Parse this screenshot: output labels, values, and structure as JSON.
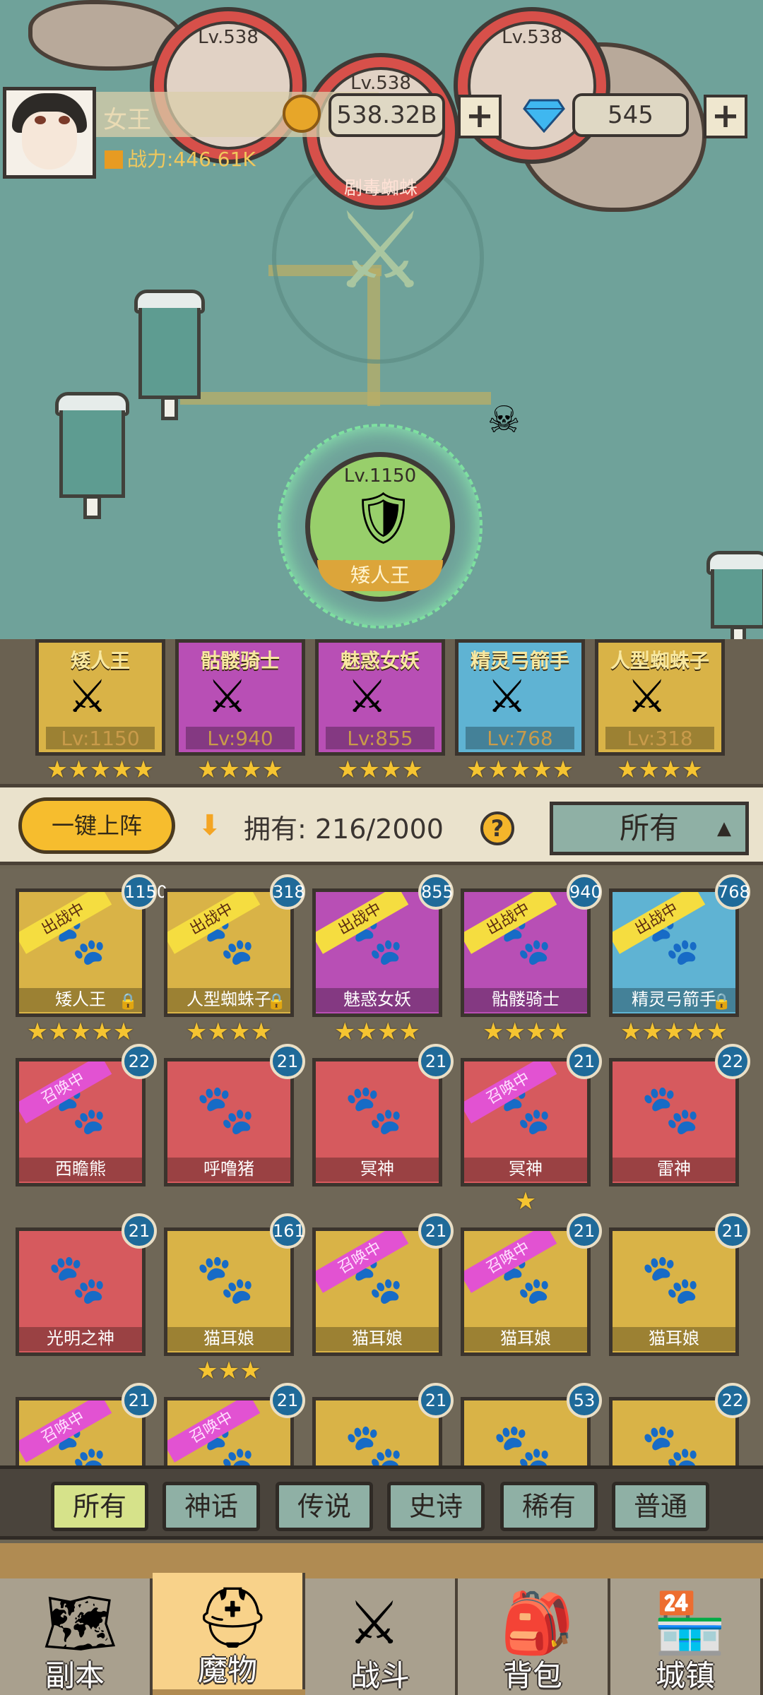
{
  "player": {
    "name": "女王",
    "power": "战力:446.61K",
    "gold": "538.32B",
    "gems": "545"
  },
  "map": {
    "enemies": [
      {
        "level": "Lv.538",
        "label": ""
      },
      {
        "level": "Lv.538",
        "label": "剧毒蜘蛛"
      },
      {
        "level": "Lv.538",
        "label": ""
      }
    ],
    "player_node": {
      "level": "Lv.1150",
      "label": "矮人王"
    }
  },
  "lineup": [
    {
      "name": "矮人王",
      "level": "Lv:1150",
      "stars": 5,
      "color": "#d9b347"
    },
    {
      "name": "骷髅骑士",
      "level": "Lv:940",
      "stars": 4,
      "color": "#b84fb5"
    },
    {
      "name": "魅惑女妖",
      "level": "Lv:855",
      "stars": 4,
      "color": "#b84fb5"
    },
    {
      "name": "精灵弓箭手",
      "level": "Lv:768",
      "stars": 5,
      "color": "#5fb3d3"
    },
    {
      "name": "人型蜘蛛子",
      "level": "Lv:318",
      "stars": 4,
      "color": "#d9b347"
    }
  ],
  "controls": {
    "deploy_label": "一键上阵",
    "owned_label": "拥有: 216/2000",
    "help": "?",
    "filter_label": "所有"
  },
  "roster": [
    {
      "name": "矮人王",
      "level": "1150",
      "ribbon": "出战中",
      "stars": 5,
      "color": "#d9b347",
      "lock": true
    },
    {
      "name": "人型蜘蛛子",
      "level": "318",
      "ribbon": "出战中",
      "stars": 4,
      "color": "#d9b347",
      "lock": true
    },
    {
      "name": "魅惑女妖",
      "level": "855",
      "ribbon": "出战中",
      "stars": 4,
      "color": "#b84fb5",
      "lock": false
    },
    {
      "name": "骷髅骑士",
      "level": "940",
      "ribbon": "出战中",
      "stars": 4,
      "color": "#b84fb5",
      "lock": false
    },
    {
      "name": "精灵弓箭手",
      "level": "768",
      "ribbon": "出战中",
      "stars": 5,
      "color": "#5fb3d3",
      "lock": true
    },
    {
      "name": "西瞻熊",
      "level": "22",
      "ribbon": "召唤中",
      "stars": 0,
      "color": "#d65a5e",
      "lock": false
    },
    {
      "name": "呼噜猪",
      "level": "21",
      "ribbon": "",
      "stars": 0,
      "color": "#d65a5e",
      "lock": false
    },
    {
      "name": "冥神",
      "level": "21",
      "ribbon": "",
      "stars": 0,
      "color": "#d65a5e",
      "lock": false
    },
    {
      "name": "冥神",
      "level": "21",
      "ribbon": "召唤中",
      "stars": 1,
      "color": "#d65a5e",
      "lock": false
    },
    {
      "name": "雷神",
      "level": "22",
      "ribbon": "",
      "stars": 0,
      "color": "#d65a5e",
      "lock": false
    },
    {
      "name": "光明之神",
      "level": "21",
      "ribbon": "",
      "stars": 0,
      "color": "#d65a5e",
      "lock": false
    },
    {
      "name": "猫耳娘",
      "level": "161",
      "ribbon": "",
      "stars": 3,
      "color": "#d9b347",
      "lock": false
    },
    {
      "name": "猫耳娘",
      "level": "21",
      "ribbon": "召唤中",
      "stars": 0,
      "color": "#d9b347",
      "lock": false
    },
    {
      "name": "猫耳娘",
      "level": "21",
      "ribbon": "召唤中",
      "stars": 0,
      "color": "#d9b347",
      "lock": false
    },
    {
      "name": "猫耳娘",
      "level": "21",
      "ribbon": "",
      "stars": 0,
      "color": "#d9b347",
      "lock": false
    },
    {
      "name": "",
      "level": "21",
      "ribbon": "召唤中",
      "stars": 0,
      "color": "#d9b347",
      "lock": false
    },
    {
      "name": "",
      "level": "21",
      "ribbon": "召唤中",
      "stars": 0,
      "color": "#d9b347",
      "lock": false
    },
    {
      "name": "",
      "level": "21",
      "ribbon": "",
      "stars": 0,
      "color": "#d9b347",
      "lock": false
    },
    {
      "name": "",
      "level": "53",
      "ribbon": "",
      "stars": 0,
      "color": "#d9b347",
      "lock": false
    },
    {
      "name": "",
      "level": "22",
      "ribbon": "",
      "stars": 0,
      "color": "#d9b347",
      "lock": false
    }
  ],
  "rarity_tabs": [
    "所有",
    "神话",
    "传说",
    "史诗",
    "稀有",
    "普通"
  ],
  "nav": [
    {
      "label": "副本",
      "icon": "map-icon"
    },
    {
      "label": "魔物",
      "icon": "helmet-icon"
    },
    {
      "label": "战斗",
      "icon": "crossed-swords-icon"
    },
    {
      "label": "背包",
      "icon": "backpack-icon"
    },
    {
      "label": "城镇",
      "icon": "shop-icon"
    }
  ],
  "colors": {
    "accent": "#f6bd2e",
    "star": "#f5c431",
    "level_badge": "#1f6a99",
    "summon_ribbon": "#e252d2",
    "battle_ribbon": "#f5dd40"
  }
}
